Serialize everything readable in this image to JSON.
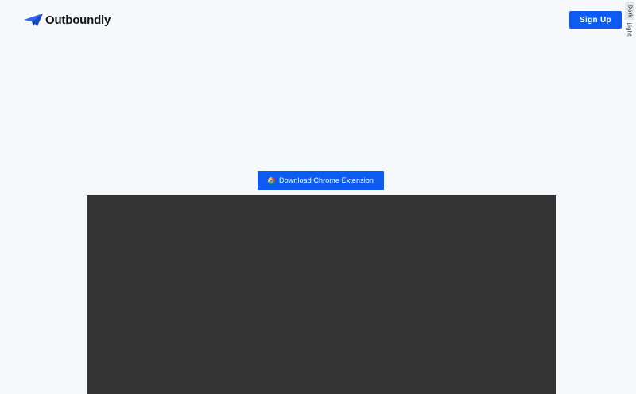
{
  "header": {
    "brand_name": "Outboundly",
    "logo_icon": "paper-plane-icon",
    "signup_label": "Sign Up"
  },
  "theme_toggle": {
    "dark_label": "Dark",
    "light_label": "Light",
    "selected": "Dark"
  },
  "main": {
    "download_label": "Download Chrome Extension",
    "download_icon": "chrome-icon"
  },
  "colors": {
    "accent": "#0d5cf2",
    "background": "#f7f8fb",
    "video_placeholder": "#333333",
    "text": "#111418"
  }
}
